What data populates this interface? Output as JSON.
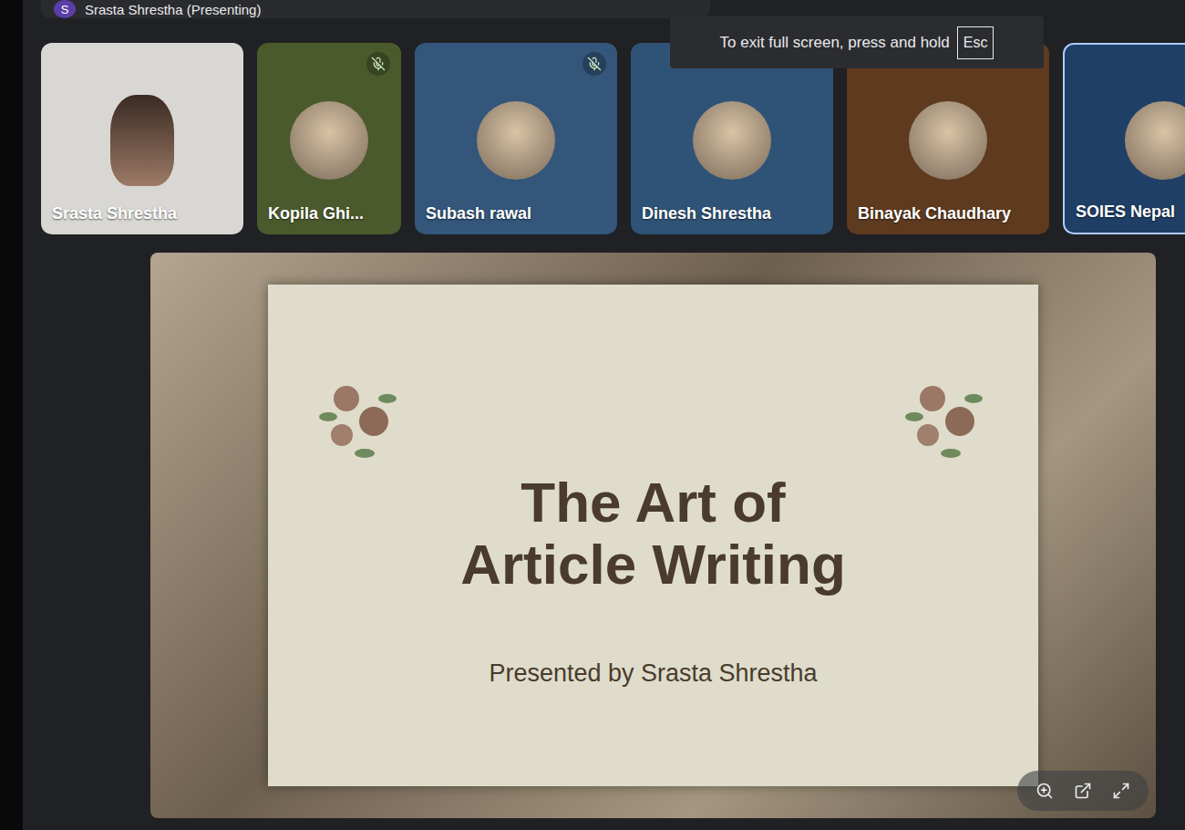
{
  "header": {
    "avatar_letter": "S",
    "label": "Srasta Shrestha (Presenting)"
  },
  "tooltip": {
    "text": "To exit full screen, press and hold",
    "key": "Esc"
  },
  "participants": [
    {
      "name": "Srasta Shrestha",
      "kind": "video",
      "muted": false,
      "color": "#d9d7d4"
    },
    {
      "name": "Kopila Ghi...",
      "kind": "avatar",
      "muted": true,
      "color": "#4b5a2c"
    },
    {
      "name": "Subash rawal",
      "kind": "avatar",
      "muted": true,
      "color": "#33567a"
    },
    {
      "name": "Dinesh Shrestha",
      "kind": "avatar",
      "muted": false,
      "color": "#2f5376"
    },
    {
      "name": "Binayak Chaudhary",
      "kind": "avatar",
      "muted": false,
      "color": "#5e3a1f"
    },
    {
      "name": "SOIES Nepal",
      "kind": "avatar",
      "muted": false,
      "color": "#1f3f66"
    }
  ],
  "slide": {
    "title_lines": [
      "The Art of",
      "Article Writing"
    ],
    "subtitle": "Presented by Srasta Shrestha"
  }
}
